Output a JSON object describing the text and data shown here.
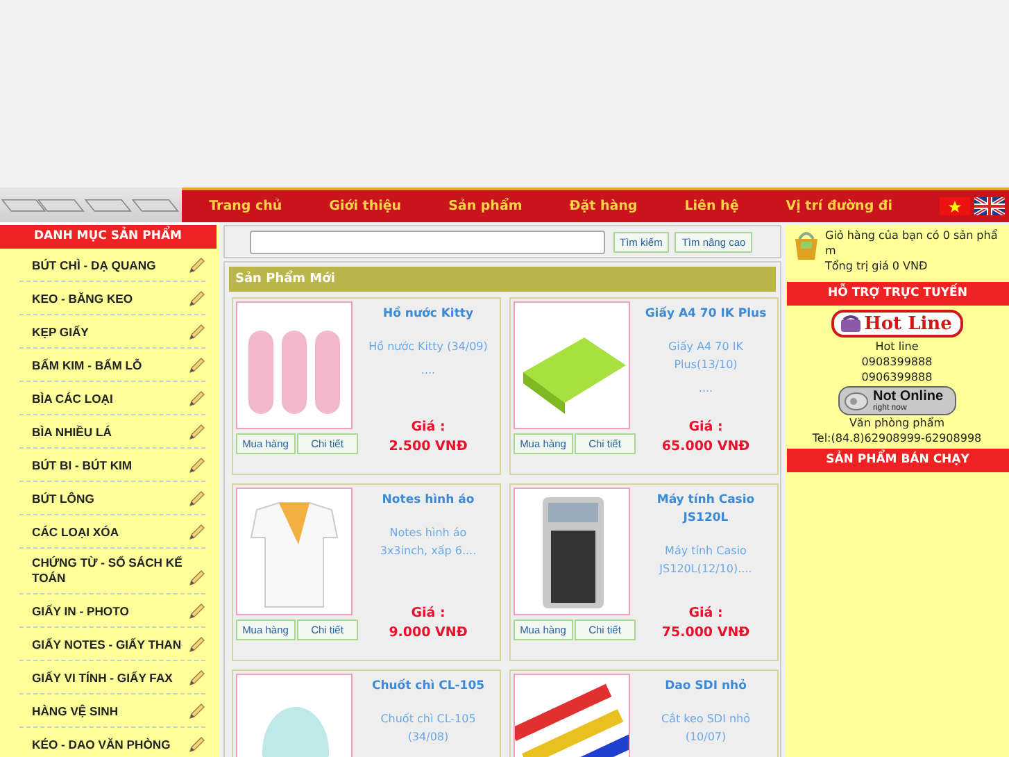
{
  "nav": {
    "items": [
      {
        "label": "Trang chủ"
      },
      {
        "label": "Giới thiệu"
      },
      {
        "label": "Sản phẩm"
      },
      {
        "label": "Đặt hàng"
      },
      {
        "label": "Liên hệ"
      },
      {
        "label": "Vị trí đường đi"
      }
    ]
  },
  "sidebar": {
    "title": "DANH MỤC SẢN PHẨM",
    "items": [
      "BÚT CHÌ - DẠ QUANG",
      "KEO - BĂNG KEO",
      "KẸP GIẤY",
      "BẤM KIM - BẤM LỖ",
      "BÌA CÁC LOẠI",
      "BÌA NHIỀU LÁ",
      "BÚT BI - BÚT KIM",
      "BÚT LÔNG",
      "CÁC LOẠI XÓA",
      "CHỨNG TỪ - SỔ SÁCH KẾ TOÁN",
      "GIẤY IN - PHOTO",
      "GIẤY NOTES - GIẤY THAN",
      "GIẤY VI TÍNH - GIẤY FAX",
      "HÀNG VỆ SINH",
      "KÉO - DAO VĂN PHÒNG"
    ]
  },
  "search": {
    "buttons": [
      "Tìm kiếm",
      "Tìm nâng cao"
    ]
  },
  "new_products": {
    "title": "Sản Phẩm Mới",
    "products": [
      {
        "name": "Hồ nước Kitty",
        "description": "Hồ nước Kitty (34/09)",
        "more": "....",
        "price_label": "Giá :",
        "price": "2.500 VNĐ",
        "buttons": [
          "Mua hàng",
          "Chi tiết"
        ]
      },
      {
        "name": "Giấy A4 70 IK Plus",
        "description": "Giấy A4 70 IK Plus(13/10)",
        "more": "....",
        "price_label": "Giá :",
        "price": "65.000 VNĐ",
        "buttons": [
          "Mua hàng",
          "Chi tiết"
        ]
      },
      {
        "name": "Notes hình áo",
        "description": "Notes hình áo 3x3inch, xấp 6....",
        "price_label": "Giá :",
        "price": "9.000 VNĐ",
        "buttons": [
          "Mua hàng",
          "Chi tiết"
        ]
      },
      {
        "name": "Máy tính Casio JS120L",
        "description": "Máy tính Casio JS120L(12/10)....",
        "price_label": "Giá :",
        "price": "75.000 VNĐ",
        "buttons": [
          "Mua hàng",
          "Chi tiết"
        ]
      },
      {
        "name": "Chuốt chì CL-105",
        "description": "Chuốt chì CL-105 (34/08)"
      },
      {
        "name": "Dao SDI nhỏ",
        "description": "Cắt keo SDI nhỏ (10/07)"
      }
    ]
  },
  "cart": {
    "text": "Giỏ hàng của bạn có 0 sản phẩm",
    "total": "Tổng trị giá 0 VNĐ"
  },
  "support": {
    "title": "HỖ TRỢ TRỰC TUYẾN",
    "hotline_badge": "Hot Line",
    "lines": [
      "Hot line",
      "0908399888",
      "0906399888"
    ],
    "status_badge": {
      "main": "Not Online",
      "sub": "right now"
    },
    "name": "Văn phòng phẩm",
    "tel": "Tel:(84.8)62908999-62908998"
  },
  "bestsellers": {
    "title": "SẢN PHẨM BÁN CHẠY"
  }
}
